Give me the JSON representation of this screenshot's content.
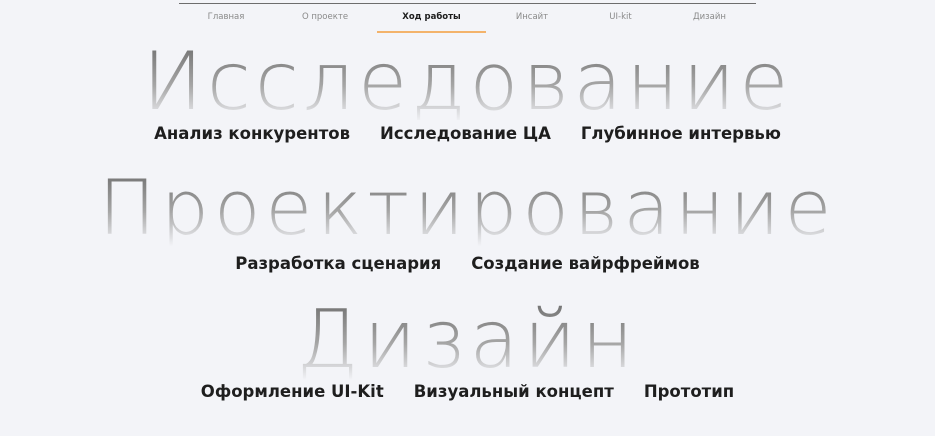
{
  "nav": {
    "items": [
      {
        "label": "Главная"
      },
      {
        "label": "О проекте"
      },
      {
        "label": "Ход работы"
      },
      {
        "label": "Инсайт"
      },
      {
        "label": "UI-kit"
      },
      {
        "label": "Дизайн"
      }
    ],
    "active": "Ход работы"
  },
  "stages": [
    {
      "title": "Исследование",
      "steps": [
        "Анализ конкурентов",
        "Исследование ЦА",
        "Глубинное интервью"
      ]
    },
    {
      "title": "Проектирование",
      "steps": [
        "Разработка сценария",
        "Создание вайрфреймов"
      ]
    },
    {
      "title": "Дизайн",
      "steps": [
        "Оформление UI-Kit",
        "Визуальный концепт",
        "Прототип"
      ]
    }
  ],
  "colors": {
    "background": "#f3f4f8",
    "active_underline": "#f3b36b",
    "text": "#1c1c1c",
    "muted": "#8a8a8a"
  }
}
